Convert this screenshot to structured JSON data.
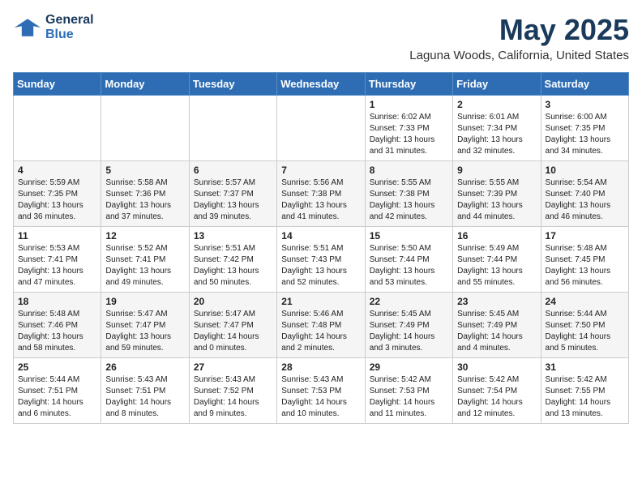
{
  "header": {
    "logo_line1": "General",
    "logo_line2": "Blue",
    "month": "May 2025",
    "location": "Laguna Woods, California, United States"
  },
  "weekdays": [
    "Sunday",
    "Monday",
    "Tuesday",
    "Wednesday",
    "Thursday",
    "Friday",
    "Saturday"
  ],
  "weeks": [
    [
      {
        "day": "",
        "info": ""
      },
      {
        "day": "",
        "info": ""
      },
      {
        "day": "",
        "info": ""
      },
      {
        "day": "",
        "info": ""
      },
      {
        "day": "1",
        "info": "Sunrise: 6:02 AM\nSunset: 7:33 PM\nDaylight: 13 hours\nand 31 minutes."
      },
      {
        "day": "2",
        "info": "Sunrise: 6:01 AM\nSunset: 7:34 PM\nDaylight: 13 hours\nand 32 minutes."
      },
      {
        "day": "3",
        "info": "Sunrise: 6:00 AM\nSunset: 7:35 PM\nDaylight: 13 hours\nand 34 minutes."
      }
    ],
    [
      {
        "day": "4",
        "info": "Sunrise: 5:59 AM\nSunset: 7:35 PM\nDaylight: 13 hours\nand 36 minutes."
      },
      {
        "day": "5",
        "info": "Sunrise: 5:58 AM\nSunset: 7:36 PM\nDaylight: 13 hours\nand 37 minutes."
      },
      {
        "day": "6",
        "info": "Sunrise: 5:57 AM\nSunset: 7:37 PM\nDaylight: 13 hours\nand 39 minutes."
      },
      {
        "day": "7",
        "info": "Sunrise: 5:56 AM\nSunset: 7:38 PM\nDaylight: 13 hours\nand 41 minutes."
      },
      {
        "day": "8",
        "info": "Sunrise: 5:55 AM\nSunset: 7:38 PM\nDaylight: 13 hours\nand 42 minutes."
      },
      {
        "day": "9",
        "info": "Sunrise: 5:55 AM\nSunset: 7:39 PM\nDaylight: 13 hours\nand 44 minutes."
      },
      {
        "day": "10",
        "info": "Sunrise: 5:54 AM\nSunset: 7:40 PM\nDaylight: 13 hours\nand 46 minutes."
      }
    ],
    [
      {
        "day": "11",
        "info": "Sunrise: 5:53 AM\nSunset: 7:41 PM\nDaylight: 13 hours\nand 47 minutes."
      },
      {
        "day": "12",
        "info": "Sunrise: 5:52 AM\nSunset: 7:41 PM\nDaylight: 13 hours\nand 49 minutes."
      },
      {
        "day": "13",
        "info": "Sunrise: 5:51 AM\nSunset: 7:42 PM\nDaylight: 13 hours\nand 50 minutes."
      },
      {
        "day": "14",
        "info": "Sunrise: 5:51 AM\nSunset: 7:43 PM\nDaylight: 13 hours\nand 52 minutes."
      },
      {
        "day": "15",
        "info": "Sunrise: 5:50 AM\nSunset: 7:44 PM\nDaylight: 13 hours\nand 53 minutes."
      },
      {
        "day": "16",
        "info": "Sunrise: 5:49 AM\nSunset: 7:44 PM\nDaylight: 13 hours\nand 55 minutes."
      },
      {
        "day": "17",
        "info": "Sunrise: 5:48 AM\nSunset: 7:45 PM\nDaylight: 13 hours\nand 56 minutes."
      }
    ],
    [
      {
        "day": "18",
        "info": "Sunrise: 5:48 AM\nSunset: 7:46 PM\nDaylight: 13 hours\nand 58 minutes."
      },
      {
        "day": "19",
        "info": "Sunrise: 5:47 AM\nSunset: 7:47 PM\nDaylight: 13 hours\nand 59 minutes."
      },
      {
        "day": "20",
        "info": "Sunrise: 5:47 AM\nSunset: 7:47 PM\nDaylight: 14 hours\nand 0 minutes."
      },
      {
        "day": "21",
        "info": "Sunrise: 5:46 AM\nSunset: 7:48 PM\nDaylight: 14 hours\nand 2 minutes."
      },
      {
        "day": "22",
        "info": "Sunrise: 5:45 AM\nSunset: 7:49 PM\nDaylight: 14 hours\nand 3 minutes."
      },
      {
        "day": "23",
        "info": "Sunrise: 5:45 AM\nSunset: 7:49 PM\nDaylight: 14 hours\nand 4 minutes."
      },
      {
        "day": "24",
        "info": "Sunrise: 5:44 AM\nSunset: 7:50 PM\nDaylight: 14 hours\nand 5 minutes."
      }
    ],
    [
      {
        "day": "25",
        "info": "Sunrise: 5:44 AM\nSunset: 7:51 PM\nDaylight: 14 hours\nand 6 minutes."
      },
      {
        "day": "26",
        "info": "Sunrise: 5:43 AM\nSunset: 7:51 PM\nDaylight: 14 hours\nand 8 minutes."
      },
      {
        "day": "27",
        "info": "Sunrise: 5:43 AM\nSunset: 7:52 PM\nDaylight: 14 hours\nand 9 minutes."
      },
      {
        "day": "28",
        "info": "Sunrise: 5:43 AM\nSunset: 7:53 PM\nDaylight: 14 hours\nand 10 minutes."
      },
      {
        "day": "29",
        "info": "Sunrise: 5:42 AM\nSunset: 7:53 PM\nDaylight: 14 hours\nand 11 minutes."
      },
      {
        "day": "30",
        "info": "Sunrise: 5:42 AM\nSunset: 7:54 PM\nDaylight: 14 hours\nand 12 minutes."
      },
      {
        "day": "31",
        "info": "Sunrise: 5:42 AM\nSunset: 7:55 PM\nDaylight: 14 hours\nand 13 minutes."
      }
    ]
  ]
}
